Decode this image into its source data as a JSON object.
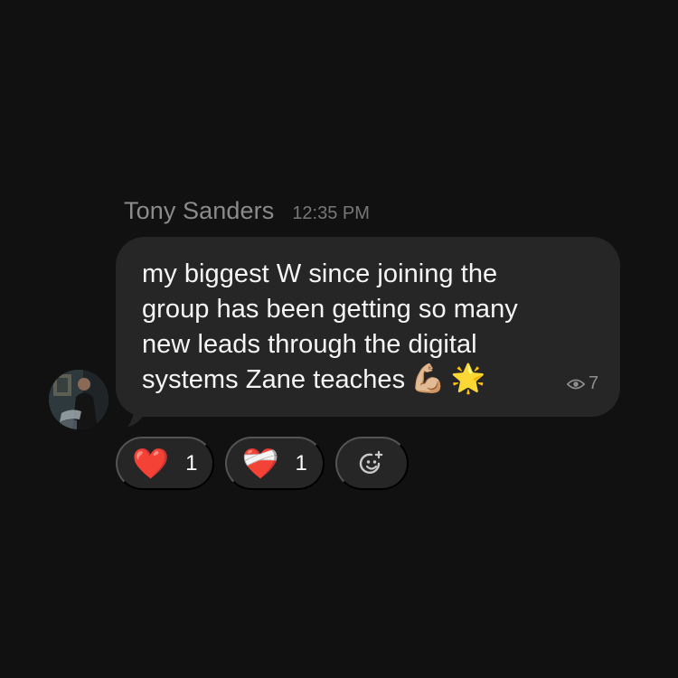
{
  "message": {
    "sender_name": "Tony Sanders",
    "timestamp": "12:35 PM",
    "text": "my biggest W since joining the group has been getting so many new leads through the digital systems Zane teaches",
    "emojis": [
      "💪🏼",
      "🌟"
    ],
    "views": "7",
    "view_icon": "eye-icon"
  },
  "avatar": {
    "icon": "avatar"
  },
  "reactions": [
    {
      "emoji": "❤️",
      "count": "1",
      "icon": "red-heart-icon"
    },
    {
      "emoji": "❤️‍🩹",
      "count": "1",
      "icon": "mending-heart-icon"
    }
  ],
  "add_reaction": {
    "icon": "add-reaction-icon"
  },
  "colors": {
    "background": "#111111",
    "bubble": "#262626",
    "muted_text": "#8b8b8b",
    "message_text": "#f5f5f5"
  }
}
